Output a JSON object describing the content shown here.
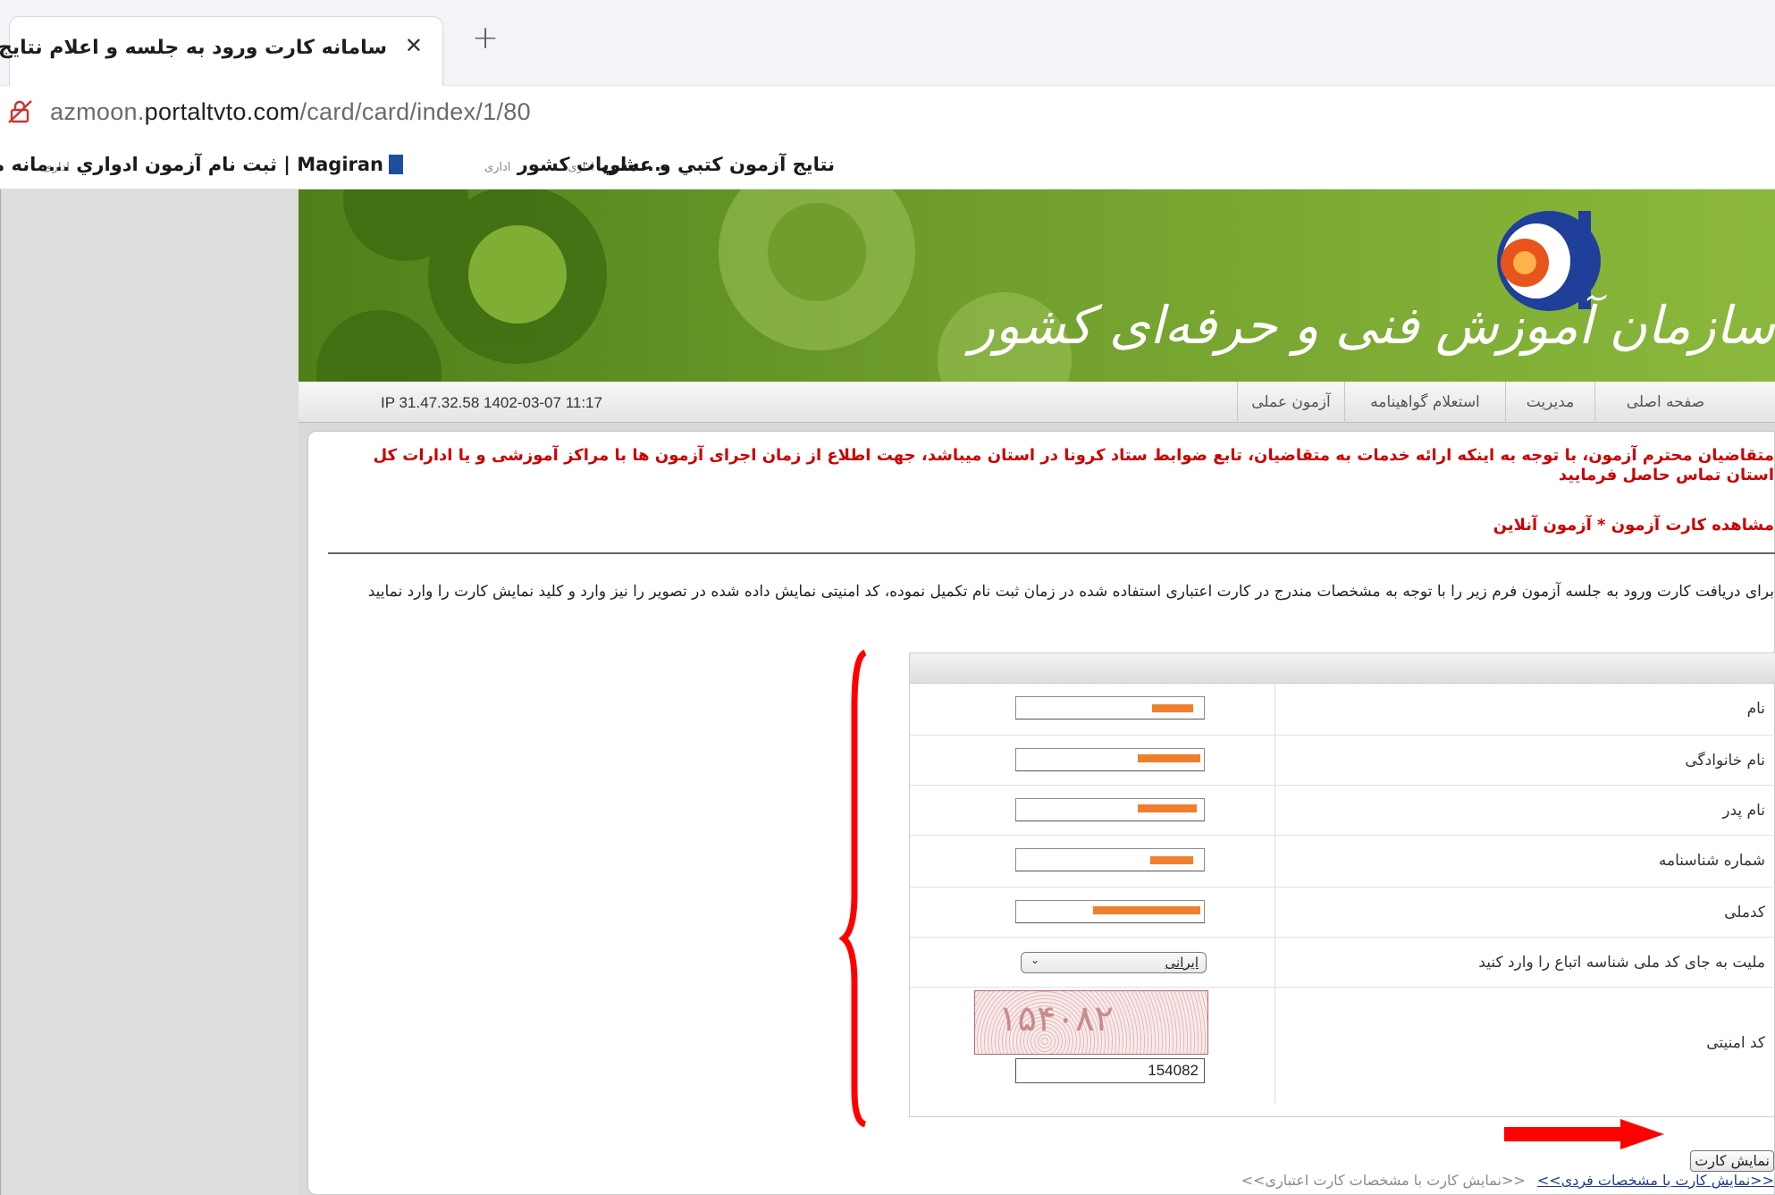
{
  "browser": {
    "tab_title": "سامانه کارت ورود به جلسه و اعلام نتایج",
    "close_glyph": "✕",
    "new_tab_glyph": "+",
    "url_host_prefix": "azmoon.",
    "url_host_main": "portaltvto.com",
    "url_path": "/card/card/index/1/80",
    "bookmarks": [
      {
        "label": "نتایج آزمون کتبي و عملي",
        "suffix": "اداری"
      },
      {
        "label": "...نشریات کشور",
        "suffix": "اداری"
      },
      {
        "label": "Magiran | ثبت نام آزمون ادواري",
        "suffix": "اداری"
      },
      {
        "label": "...مانه ملی",
        "suffix": ""
      }
    ]
  },
  "site": {
    "logo_text": "سازمان آموزش فنی و حرفه‌ای کشور",
    "nav": [
      "صفحه اصلی",
      "مدیریت",
      "استعلام گواهینامه",
      "آزمون عملی"
    ],
    "ip_info": "IP 31.47.32.58    1402-03-07 11:17"
  },
  "content": {
    "notice": "متقاضیان محترم آزمون، با توجه به اینکه ارائه خدمات به متقاضیان، تابع ضوابط ستاد کرونا در استان میباشد، جهت اطلاع از زمان اجرای آزمون ها با مراکز آموزشی و یا ادارات کل استان تماس حاصل فرمایید",
    "section_title": "مشاهده کارت آزمون * آزمون آنلاین",
    "instructions": "برای دریافت کارت ورود به جلسه آزمون فرم زیر را با توجه به مشخصات مندرج در کارت اعتباری استفاده شده در زمان ثبت نام تکمیل نموده، کد امنیتی نمایش داده شده در تصویر را نیز وارد و کلید نمایش کارت را وارد نمایید"
  },
  "form": {
    "fields": [
      {
        "label": "نام",
        "value": ""
      },
      {
        "label": "نام خانوادگی",
        "value": ""
      },
      {
        "label": "نام پدر",
        "value": ""
      },
      {
        "label": "شماره شناسنامه",
        "value": ""
      },
      {
        "label": "کدملی",
        "value": ""
      }
    ],
    "nationality_label": "ملیت به جای کد ملی شناسه اتباع را وارد کنید",
    "nationality_value": "ایرانی",
    "security_label": "کد امنیتی",
    "captcha_text": "۱۵۴۰۸۲",
    "captcha_value": "154082",
    "show_card_button": "نمایش کارت",
    "link_personal": "<<نمایش کارت با مشخصات فردی>>",
    "link_credit": "<<نمایش کارت با مشخصات کارت اعتباری>>"
  },
  "colors": {
    "accent_red": "#cc0000",
    "redaction_orange": "#ee7f2d",
    "annotation_red": "#ff0000",
    "banner_green": "#6f9e2c"
  }
}
